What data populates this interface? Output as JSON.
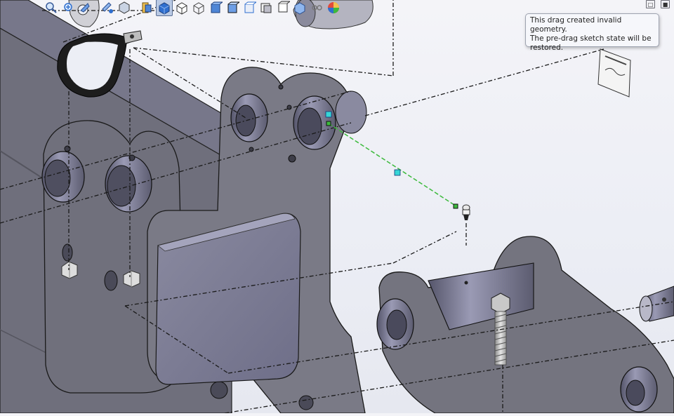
{
  "toolbar": {
    "icons": [
      "zoom-to-fit-icon",
      "zoom-area-icon",
      "previous-view-icon",
      "section-view-icon",
      "dynamic-annotation-icon",
      "view-orientation-icon",
      "display-style-icon",
      "hide-show-items-icon",
      "edit-appearance-icon",
      "apply-scene-icon",
      "view-settings-icon"
    ],
    "accent": "#2f6fcf"
  },
  "tooltip": {
    "line1": "This drag created invalid geometry.",
    "line2": "The pre-drag sketch state will be",
    "line3": "restored."
  },
  "colors": {
    "part_fill": "#6e6e7a",
    "part_dark": "#4a4a55",
    "sketch_line": "#3cba3c",
    "handle": "#36d6d6",
    "explode_line": "#1a1a1a"
  }
}
